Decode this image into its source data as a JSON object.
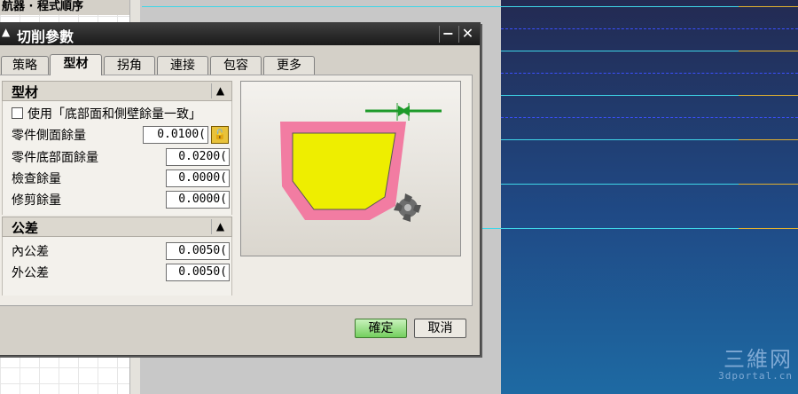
{
  "navigator": {
    "title": "航器 · 程式順序"
  },
  "dialog": {
    "title": "切削參數",
    "buttons": {
      "minimize": "−",
      "close": "✕"
    },
    "tabs": [
      "策略",
      "型材",
      "拐角",
      "連接",
      "包容",
      "更多"
    ],
    "active_tab": "型材",
    "section_stock": {
      "header": "型材",
      "checkbox_label": "使用「底部面和側壁餘量一致」",
      "checkbox_checked": false,
      "rows": [
        {
          "label": "零件側面餘量",
          "value": "0.0100("
        },
        {
          "label": "零件底部面餘量",
          "value": "0.0200("
        },
        {
          "label": "檢查餘量",
          "value": "0.0000("
        },
        {
          "label": "修剪餘量",
          "value": "0.0000("
        }
      ]
    },
    "section_tolerance": {
      "header": "公差",
      "rows": [
        {
          "label": "內公差",
          "value": "0.0050("
        },
        {
          "label": "外公差",
          "value": "0.0050("
        }
      ]
    },
    "ok_label": "確定",
    "cancel_label": "取消"
  },
  "watermark": {
    "big": "三維网",
    "small": "3dportal.cn"
  },
  "colors": {
    "stock_pink": "#f27ca2",
    "part_yellow": "#eeee00",
    "arrow_green": "#1e9a2a"
  }
}
